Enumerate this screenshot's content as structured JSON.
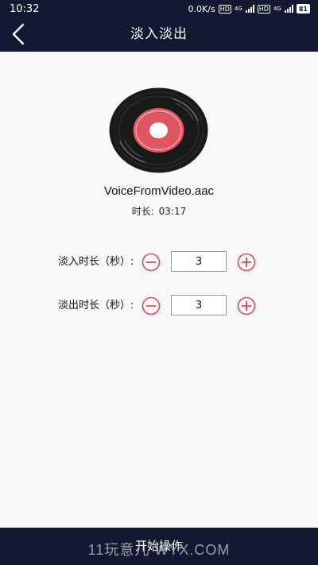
{
  "status_bar": {
    "time": "10:32",
    "network_speed": "0.0K/s",
    "hd_badge": "HD",
    "network_type": "4G",
    "battery": "81"
  },
  "header": {
    "title": "淡入淡出"
  },
  "file": {
    "name": "VoiceFromVideo.aac",
    "duration_label": "时长:",
    "duration_value": "03:17"
  },
  "settings": {
    "fade_in": {
      "label": "淡入时长（秒）:",
      "value": "3"
    },
    "fade_out": {
      "label": "淡出时长（秒）:",
      "value": "3"
    }
  },
  "bottom": {
    "start_label": "开始操作"
  },
  "watermark": "11玩意儿 WYX.COM",
  "colors": {
    "dark_bar": "#141830",
    "accent_red": "#d94a55",
    "background": "#f8f8f8"
  }
}
